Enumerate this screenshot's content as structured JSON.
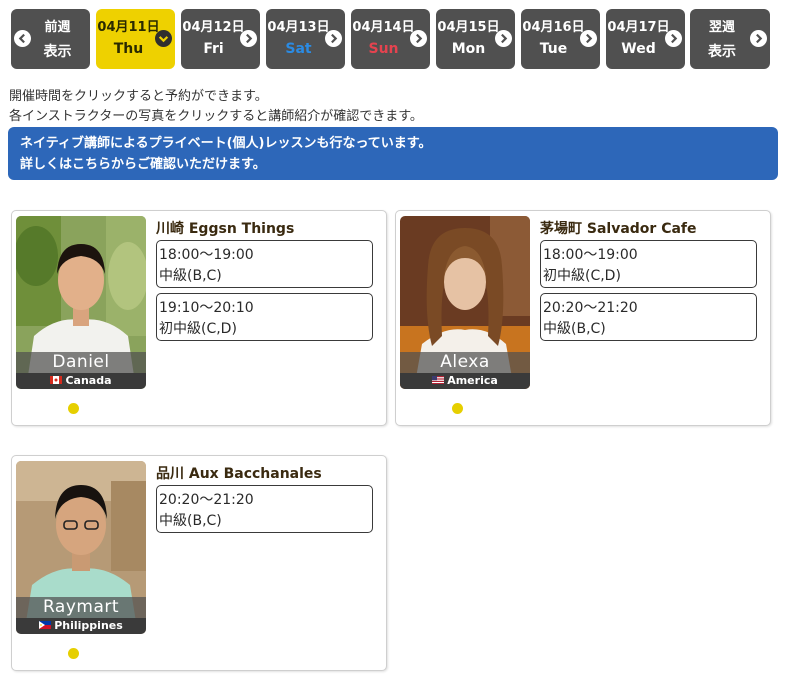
{
  "daynav": {
    "prev": {
      "line1": "前週",
      "line2": "表示"
    },
    "days": [
      {
        "date": "04月11日",
        "weekday": "Thu",
        "active": true
      },
      {
        "date": "04月12日",
        "weekday": "Fri"
      },
      {
        "date": "04月13日",
        "weekday": "Sat"
      },
      {
        "date": "04月14日",
        "weekday": "Sun"
      },
      {
        "date": "04月15日",
        "weekday": "Mon"
      },
      {
        "date": "04月16日",
        "weekday": "Tue"
      },
      {
        "date": "04月17日",
        "weekday": "Wed"
      }
    ],
    "next": {
      "line1": "翌週",
      "line2": "表示"
    }
  },
  "notice": {
    "line1": "開催時間をクリックすると予約ができます。",
    "line2": "各インストラクターの写真をクリックすると講師紹介が確認できます。"
  },
  "banner": {
    "line1": "ネイティブ講師によるプライベート(個人)レッスンも行なっています。",
    "line2": "詳しくはこちらからご確認いただけます。"
  },
  "colors": {
    "nav_bg": "#505050",
    "active_day": "#eed100",
    "sat": "#2b8be3",
    "sun": "#e5434f",
    "banner": "#2d67b9",
    "status_dot": "#e6cf00"
  },
  "lessons": [
    {
      "instructor": "Daniel",
      "country": "Canada",
      "venue": "川崎 Eggsn Things",
      "slots": [
        {
          "time": "18:00〜19:00",
          "level": "中級(B,C)"
        },
        {
          "time": "19:10〜20:10",
          "level": "初中級(C,D)"
        }
      ]
    },
    {
      "instructor": "Alexa",
      "country": "America",
      "venue": "茅場町 Salvador Cafe",
      "slots": [
        {
          "time": "18:00〜19:00",
          "level": "初中級(C,D)"
        },
        {
          "time": "20:20〜21:20",
          "level": "中級(B,C)"
        }
      ]
    },
    {
      "instructor": "Raymart",
      "country": "Philippines",
      "venue": "品川 Aux Bacchanales",
      "slots": [
        {
          "time": "20:20〜21:20",
          "level": "中級(B,C)"
        }
      ]
    }
  ]
}
